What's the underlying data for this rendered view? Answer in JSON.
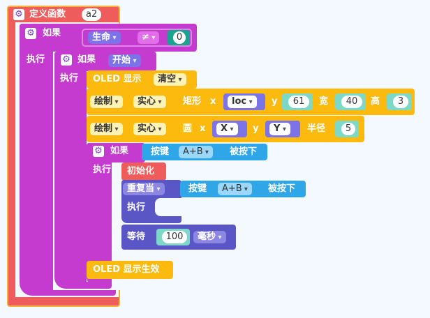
{
  "define": {
    "label": "定义函数",
    "name": "a2"
  },
  "if_outer": {
    "label": "如果",
    "do": "执行",
    "var": "生命",
    "op": "≠",
    "value": "0"
  },
  "if_start": {
    "label": "如果",
    "do": "执行",
    "var": "开始"
  },
  "oled_show": {
    "label": "OLED 显示",
    "mode": "清空"
  },
  "draw_rect": {
    "draw": "绘制",
    "fill": "实心",
    "shape": "矩形",
    "x_label": "x",
    "x_var": "loc",
    "y_label": "y",
    "y_val": "61",
    "w_label": "宽",
    "w_val": "40",
    "h_label": "高",
    "h_val": "3"
  },
  "draw_circle": {
    "draw": "绘制",
    "fill": "实心",
    "shape": "圆",
    "x_label": "x",
    "x_var": "X",
    "y_label": "y",
    "y_var": "Y",
    "r_label": "半径",
    "r_val": "5"
  },
  "if_key": {
    "label": "如果",
    "do": "执行",
    "key_label": "按键",
    "key": "A+B",
    "state": "被按下"
  },
  "init": {
    "label": "初始化"
  },
  "repeat": {
    "mode": "重复当",
    "do": "执行",
    "key_label": "按键",
    "key": "A+B",
    "state": "被按下"
  },
  "wait": {
    "label": "等待",
    "value": "100",
    "unit": "毫秒"
  },
  "oled_effect": {
    "label": "OLED 显示生效"
  },
  "colors": {
    "define": "#ef5c5c",
    "control": "#c63bcf",
    "oled": "#fcba0e",
    "key": "#2ea6e8",
    "loop": "#5b56c6",
    "variable": "#7d73e8",
    "teal": "#1aa38f"
  }
}
